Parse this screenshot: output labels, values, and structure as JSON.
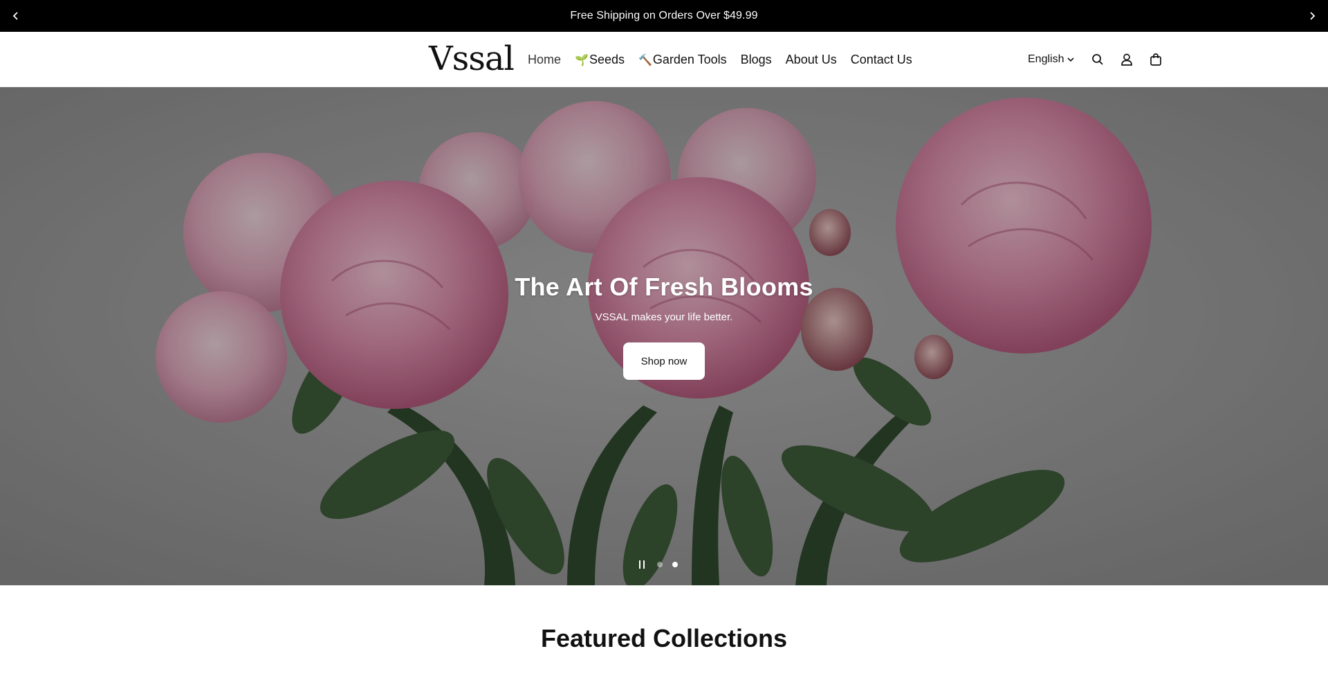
{
  "announcement": {
    "text": "Free Shipping on Orders Over $49.99",
    "prev_icon": "chevron-left-icon",
    "next_icon": "chevron-right-icon"
  },
  "header": {
    "logo": "Vssal",
    "nav": [
      {
        "label": "Home",
        "emoji": ""
      },
      {
        "label": "Seeds",
        "emoji": "🌱"
      },
      {
        "label": "Garden Tools",
        "emoji": "🔨"
      },
      {
        "label": "Blogs",
        "emoji": ""
      },
      {
        "label": "About Us",
        "emoji": ""
      },
      {
        "label": "Contact Us",
        "emoji": ""
      }
    ],
    "language": "English",
    "icons": [
      "search-icon",
      "account-icon",
      "cart-icon"
    ]
  },
  "hero": {
    "title": "The Art Of Fresh Blooms",
    "subtitle": "VSSAL makes your life better.",
    "button": "Shop now",
    "slides": 2,
    "active_slide": 2
  },
  "featured": {
    "title": "Featured Collections"
  },
  "colors": {
    "announcement_bg": "#000000",
    "peony_pink": "#d98aa6",
    "leaf_green": "#3f5a3a",
    "backdrop_gray": "#8a8a8a"
  }
}
